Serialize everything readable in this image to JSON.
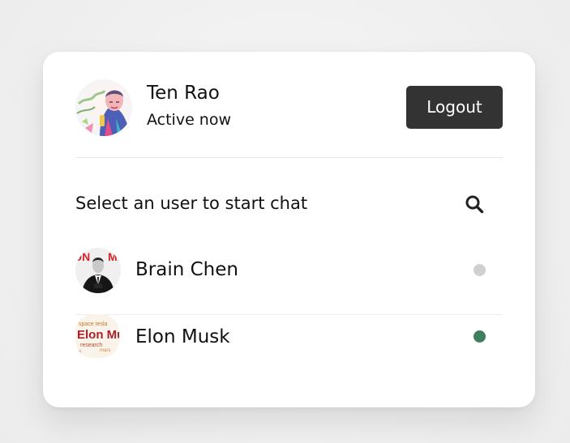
{
  "current_user": {
    "name": "Ten Rao",
    "status": "Active now",
    "avatar_icon": "user-avatar-artwork"
  },
  "header": {
    "logout_label": "Logout"
  },
  "search": {
    "label": "Select an user to start chat",
    "icon": "search-icon"
  },
  "users": [
    {
      "name": "Brain Chen",
      "status": "offline",
      "status_color": "#d0d0d0",
      "avatar_icon": "user-avatar-suit"
    },
    {
      "name": "Elon Musk",
      "status": "online",
      "status_color": "#3f7f5c",
      "avatar_icon": "user-avatar-wordcloud"
    }
  ],
  "colors": {
    "background": "#efefef",
    "card": "#ffffff",
    "button": "#333333",
    "button_text": "#ffffff"
  }
}
